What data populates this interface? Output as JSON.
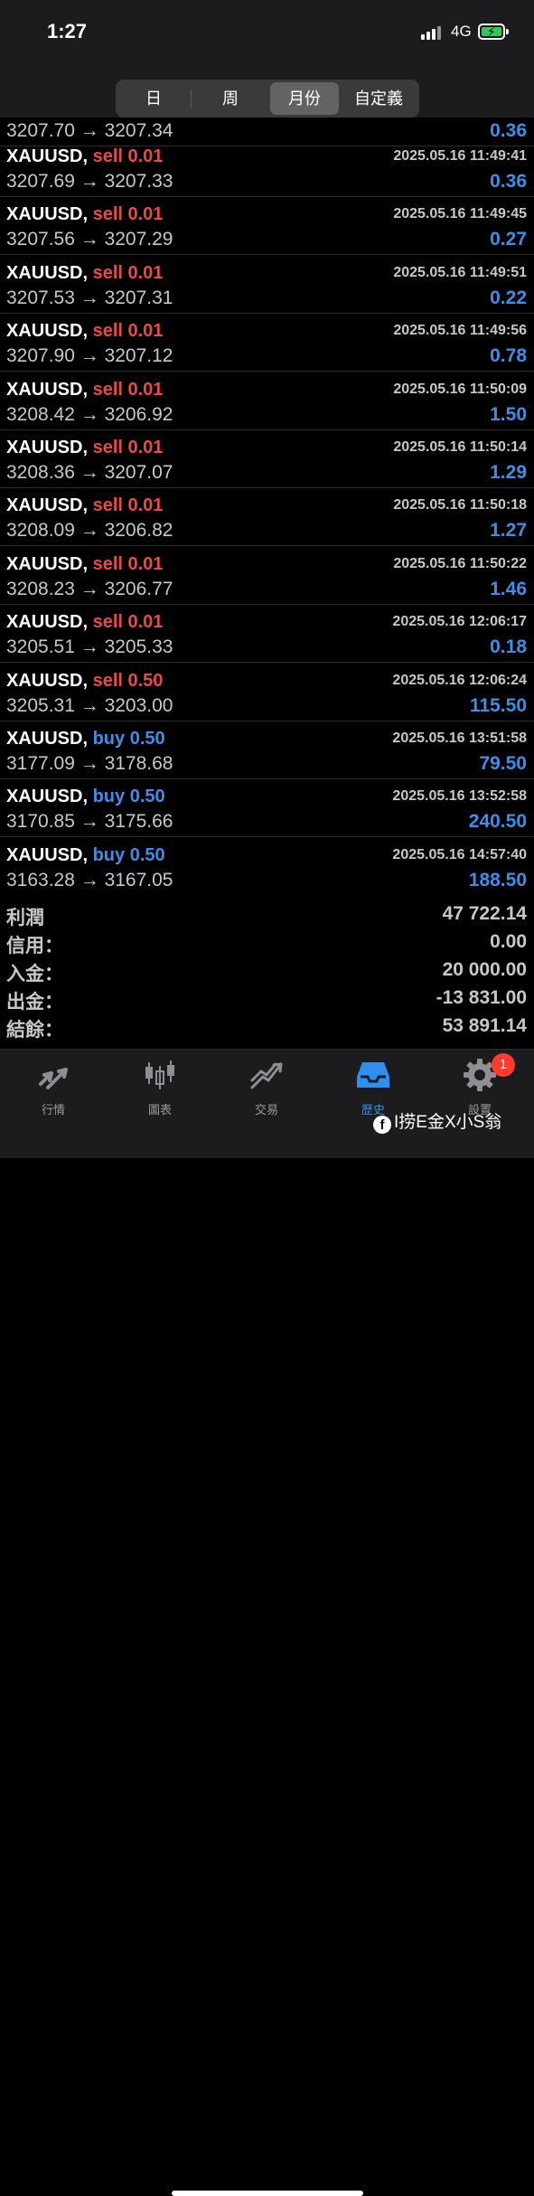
{
  "status_bar": {
    "time": "1:27",
    "network": "4G"
  },
  "segmented": {
    "options": [
      "日",
      "周",
      "月份",
      "自定義"
    ],
    "selected": "月份"
  },
  "partial_row": {
    "prices": "3207.70 → 3207.34",
    "profit": "0.36"
  },
  "trades": [
    {
      "symbol": "XAUUSD,",
      "side": "sell",
      "volume": "0.01",
      "datetime": "2025.05.16 11:49:41",
      "prices": "3207.69 → 3207.33",
      "profit": "0.36"
    },
    {
      "symbol": "XAUUSD,",
      "side": "sell",
      "volume": "0.01",
      "datetime": "2025.05.16 11:49:45",
      "prices": "3207.56 → 3207.29",
      "profit": "0.27"
    },
    {
      "symbol": "XAUUSD,",
      "side": "sell",
      "volume": "0.01",
      "datetime": "2025.05.16 11:49:51",
      "prices": "3207.53 → 3207.31",
      "profit": "0.22"
    },
    {
      "symbol": "XAUUSD,",
      "side": "sell",
      "volume": "0.01",
      "datetime": "2025.05.16 11:49:56",
      "prices": "3207.90 → 3207.12",
      "profit": "0.78"
    },
    {
      "symbol": "XAUUSD,",
      "side": "sell",
      "volume": "0.01",
      "datetime": "2025.05.16 11:50:09",
      "prices": "3208.42 → 3206.92",
      "profit": "1.50"
    },
    {
      "symbol": "XAUUSD,",
      "side": "sell",
      "volume": "0.01",
      "datetime": "2025.05.16 11:50:14",
      "prices": "3208.36 → 3207.07",
      "profit": "1.29"
    },
    {
      "symbol": "XAUUSD,",
      "side": "sell",
      "volume": "0.01",
      "datetime": "2025.05.16 11:50:18",
      "prices": "3208.09 → 3206.82",
      "profit": "1.27"
    },
    {
      "symbol": "XAUUSD,",
      "side": "sell",
      "volume": "0.01",
      "datetime": "2025.05.16 11:50:22",
      "prices": "3208.23 → 3206.77",
      "profit": "1.46"
    },
    {
      "symbol": "XAUUSD,",
      "side": "sell",
      "volume": "0.01",
      "datetime": "2025.05.16 12:06:17",
      "prices": "3205.51 → 3205.33",
      "profit": "0.18"
    },
    {
      "symbol": "XAUUSD,",
      "side": "sell",
      "volume": "0.50",
      "datetime": "2025.05.16 12:06:24",
      "prices": "3205.31 → 3203.00",
      "profit": "115.50"
    },
    {
      "symbol": "XAUUSD,",
      "side": "buy",
      "volume": "0.50",
      "datetime": "2025.05.16 13:51:58",
      "prices": "3177.09 → 3178.68",
      "profit": "79.50"
    },
    {
      "symbol": "XAUUSD,",
      "side": "buy",
      "volume": "0.50",
      "datetime": "2025.05.16 13:52:58",
      "prices": "3170.85 → 3175.66",
      "profit": "240.50"
    },
    {
      "symbol": "XAUUSD,",
      "side": "buy",
      "volume": "0.50",
      "datetime": "2025.05.16 14:57:40",
      "prices": "3163.28 → 3167.05",
      "profit": "188.50"
    }
  ],
  "summary": [
    {
      "label": "利潤",
      "value": "47 722.14"
    },
    {
      "label": "信用：",
      "value": "0.00"
    },
    {
      "label": "入金：",
      "value": "20 000.00"
    },
    {
      "label": "出金：",
      "value": "-13 831.00"
    },
    {
      "label": "結餘：",
      "value": "53 891.14"
    }
  ],
  "tabs": [
    {
      "label": "行情",
      "icon": "quotes-arrows-icon"
    },
    {
      "label": "圖表",
      "icon": "candlestick-icon"
    },
    {
      "label": "交易",
      "icon": "trade-trend-icon"
    },
    {
      "label": "歷史",
      "icon": "history-tray-icon",
      "active": true
    },
    {
      "label": "設置",
      "icon": "gear-icon",
      "badge": "1"
    }
  ],
  "watermark": "I捞E金X小S翁",
  "colors": {
    "sell": "#e94a43",
    "buy": "#3d8ee9",
    "accent": "#2f8ff0",
    "background": "#000000"
  }
}
